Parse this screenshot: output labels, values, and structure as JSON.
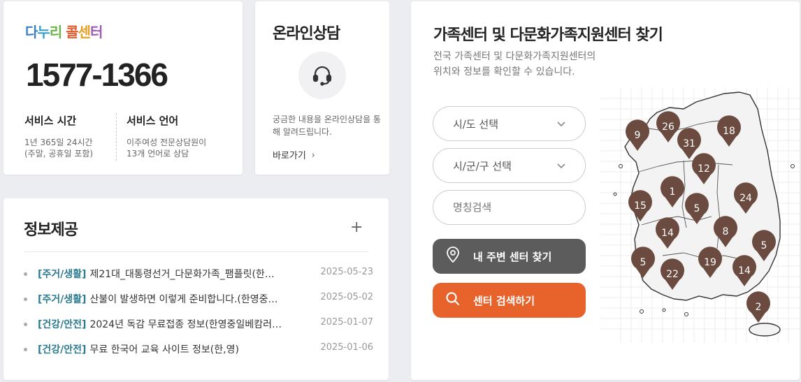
{
  "call_center": {
    "logo_parts": [
      "다",
      "누",
      "리",
      " 콜",
      "센",
      "터"
    ],
    "logo_colors": [
      "#3a7fc4",
      "#3aa0c8",
      "#6ab54a",
      "#e35a2c",
      "#e8a022",
      "#9b5ab8"
    ],
    "phone": "1577-1366",
    "service_time_label": "서비스 시간",
    "service_time_desc": "1년 365일 24시간\n(주말, 공휴일 포함)",
    "service_lang_label": "서비스 언어",
    "service_lang_desc": "이주여성 전문상담원이\n13개 언어로 상담"
  },
  "online": {
    "title": "온라인상담",
    "desc": "궁금한 내용을 온라인상담을 통해 알려드립니다.",
    "link_label": "바로가기",
    "icon": "headset-icon"
  },
  "info": {
    "title": "정보제공",
    "more_icon": "plus-icon",
    "items": [
      {
        "category": "[주거/생활]",
        "title": "제21대_대통령선거_다문화가족_팸플릿(한…",
        "date": "2025-05-23"
      },
      {
        "category": "[주거/생활]",
        "title": "산불이 발생하면 이렇게 준비합니다.(한영중…",
        "date": "2025-05-02"
      },
      {
        "category": "[건강/안전]",
        "title": "2024년 독감 무료접종 정보(한영중일베캄러…",
        "date": "2025-01-07"
      },
      {
        "category": "[건강/안전]",
        "title": "무료 한국어 교육 사이트 정보(한,영)",
        "date": "2025-01-06"
      }
    ]
  },
  "find": {
    "title": "가족센터 및 다문화가족지원센터 찾기",
    "subtitle_line1": "전국 가족센터 및 다문화가족지원센터의",
    "subtitle_line2": "위치와 정보를 확인할 수 있습니다.",
    "sido_select": "시/도 선택",
    "sigungu_select": "시/군/구 선택",
    "name_search_placeholder": "명칭검색",
    "near_button": "내 주변 센터 찾기",
    "search_button": "센터 검색하기",
    "accent": "#e8622b",
    "pin_color": "#6b4a40",
    "regions": [
      {
        "name": "incheon",
        "count": "9"
      },
      {
        "name": "seoul",
        "count": "26"
      },
      {
        "name": "gyeonggi",
        "count": "31"
      },
      {
        "name": "gangwon",
        "count": "18"
      },
      {
        "name": "chungbuk",
        "count": "12"
      },
      {
        "name": "sejong",
        "count": "1"
      },
      {
        "name": "chungnam",
        "count": "15"
      },
      {
        "name": "daejeon",
        "count": "5"
      },
      {
        "name": "gyeongbuk",
        "count": "24"
      },
      {
        "name": "jeonbuk",
        "count": "14"
      },
      {
        "name": "daegu",
        "count": "8"
      },
      {
        "name": "gwangju",
        "count": "5"
      },
      {
        "name": "jeonnam",
        "count": "22"
      },
      {
        "name": "gyeongnam",
        "count": "19"
      },
      {
        "name": "busan",
        "count": "14"
      },
      {
        "name": "ulsan",
        "count": "5"
      },
      {
        "name": "jeju",
        "count": "2"
      }
    ]
  }
}
